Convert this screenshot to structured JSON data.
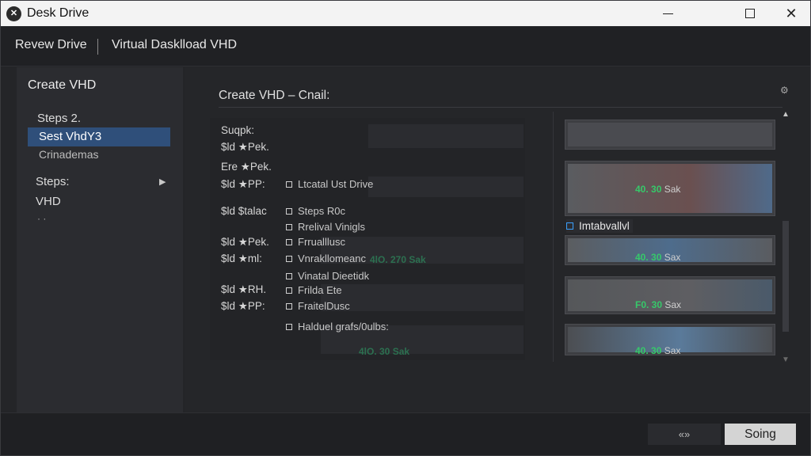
{
  "window": {
    "title": "Desk Drive",
    "close_glyph": "✕",
    "logo_glyph": "✕"
  },
  "header": {
    "crumbs": [
      "Revew Drive",
      "Virtual Dasklload VHD"
    ]
  },
  "sidebar": {
    "title": "Create VHD",
    "items": [
      {
        "label": "Steps 2."
      },
      {
        "label": "Sest VhdY3",
        "selected": true
      },
      {
        "label": "Crinademas"
      },
      {
        "label": "Steps:",
        "has_arrow": true
      },
      {
        "label": "VHD"
      },
      {
        "label": "· ·"
      }
    ],
    "arrow_glyph": "▶"
  },
  "content": {
    "title": "Create VHD  –  Cnail:",
    "gear_glyph": "⚙",
    "left_labels": [
      "Suqpk:",
      "$ld ★Pek.",
      "Ere ★Pek.",
      "$ld ★PP:",
      "$ld $talac",
      "$ld ★Pek.",
      "$ld ★ml:",
      "$ld ★RH.",
      "$ld ★PP:"
    ],
    "options": [
      "Ltcatal Ust Drive",
      "Steps R0c",
      "Rrelival Vinigls",
      "Frrualllusc",
      "Vnrakllomeanc",
      "Vinatal Dieetidk",
      "Frilda Ete",
      "FraitelDusc",
      "Halduel grafs/0ulbs:"
    ],
    "ghost_stats": [
      "4lO. 270 Sak",
      "4lO. 30 Sak"
    ],
    "thumb_label": "Imtabvallvl",
    "thumb_stats": [
      {
        "value": "40. 30",
        "unit": "Sak"
      },
      {
        "value": "40. 30",
        "unit": "Sax"
      },
      {
        "value": "F0. 30",
        "unit": "Sax"
      },
      {
        "value": "40. 30",
        "unit": "Sax"
      }
    ],
    "scroll_up": "▲",
    "scroll_down": "▼"
  },
  "footer": {
    "secondary_label": "«»",
    "primary_label": "Soing"
  }
}
